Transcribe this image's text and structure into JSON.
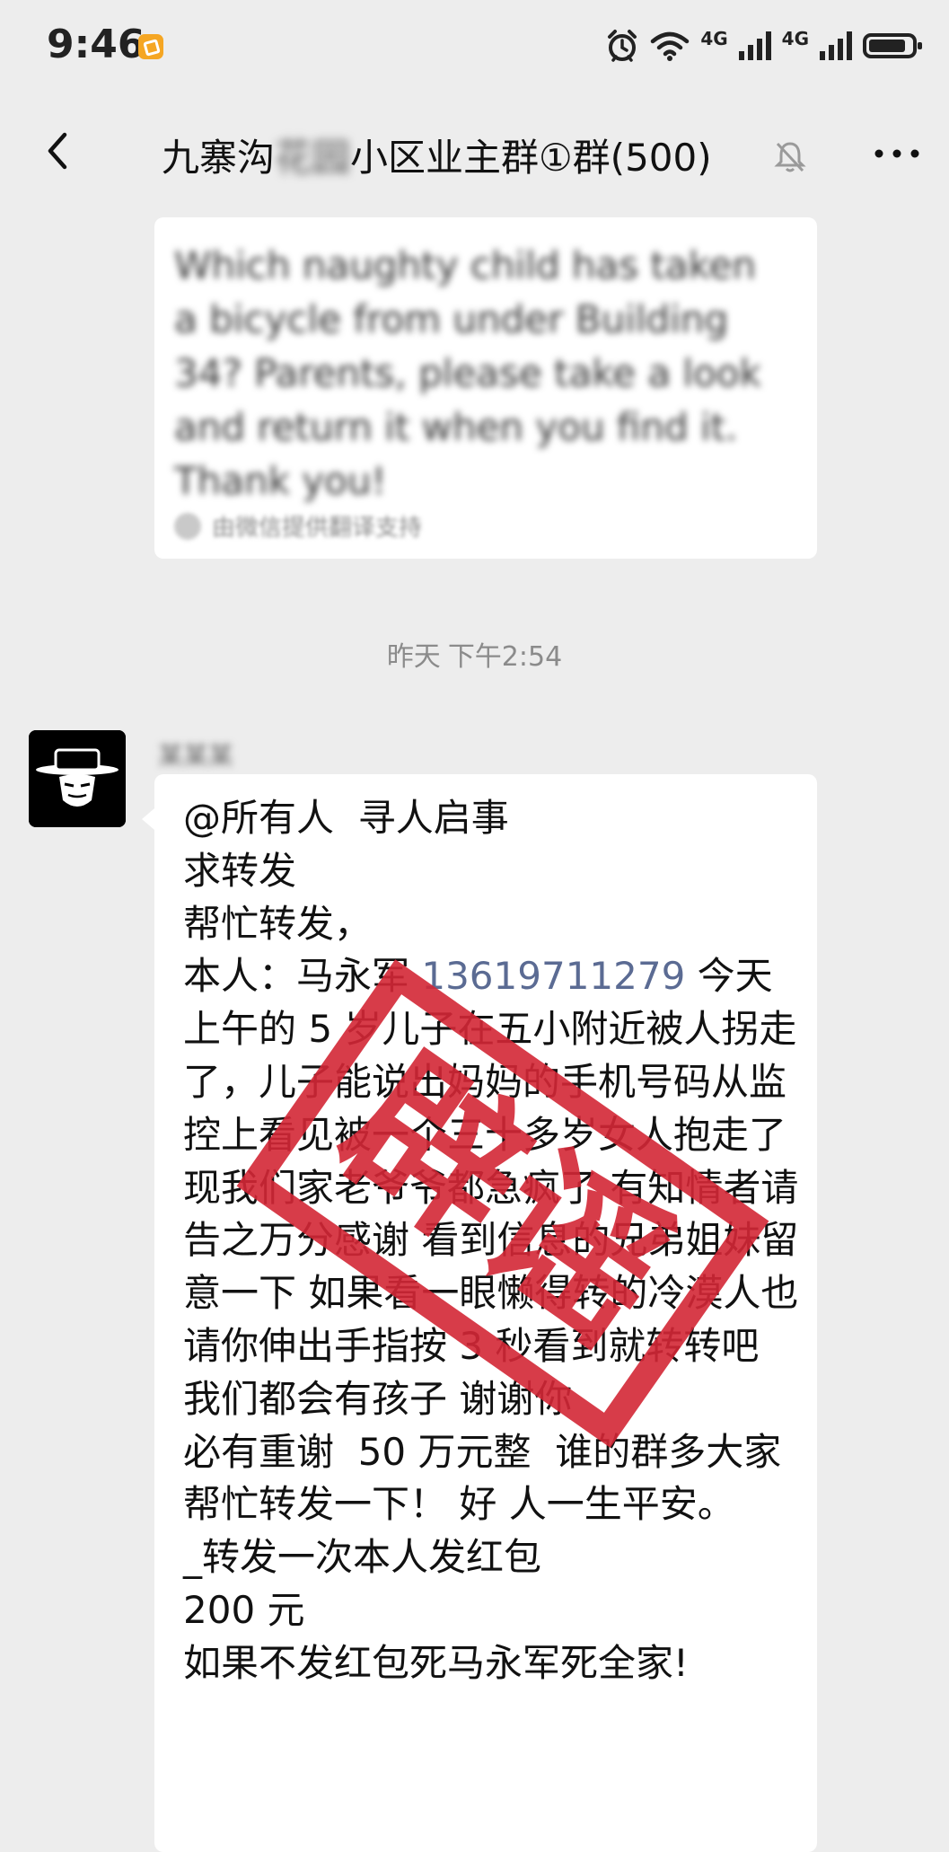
{
  "status_bar": {
    "time": "9:46",
    "network": [
      "4G",
      "4G"
    ],
    "colors": {
      "badge": "#f5a623"
    }
  },
  "header": {
    "title_prefix": "九寨沟",
    "title_redacted": "花园",
    "title_suffix": "小区业主群①群(500)",
    "icons": [
      "back-icon",
      "mute-bell-icon",
      "more-icon"
    ]
  },
  "translation_message": {
    "text": "Which naughty child has taken a bicycle from under Building 34? Parents, please take a look and return it when you find it. Thank you!",
    "source_note": "由微信提供翻译支持"
  },
  "timestamp": {
    "day": "昨天",
    "time": "下午2:54"
  },
  "main_message": {
    "sender": "某某某",
    "lines": [
      "@所有人  寻人启事",
      "求转发",
      "",
      "帮忙转发，",
      {
        "pre": "本人：马永军 ",
        "phone": "13619711279",
        "post": " 今天上午的 5 岁儿子在五小附近被人拐走了，儿子能说出妈妈的手机号码从监控上看见被一个三十多岁女人抱走了现我们家老爷爷都急疯了 有知情者请告之万分感谢 看到信息的兄弟姐妹留意一下 如果看一眼懒得转的冷漠人也请你伸出手指按 3 秒看到就转转吧 我们都会有孩子 谢谢你"
      },
      "必有重谢  50 万元整  谁的群多大家帮忙转发一下！ 好 人一生平安。",
      "_转发一次本人发红包",
      "200 元",
      "如果不发红包死马永军死全家!"
    ]
  },
  "stamp": {
    "text": "辟谣",
    "color": "#d32736"
  }
}
